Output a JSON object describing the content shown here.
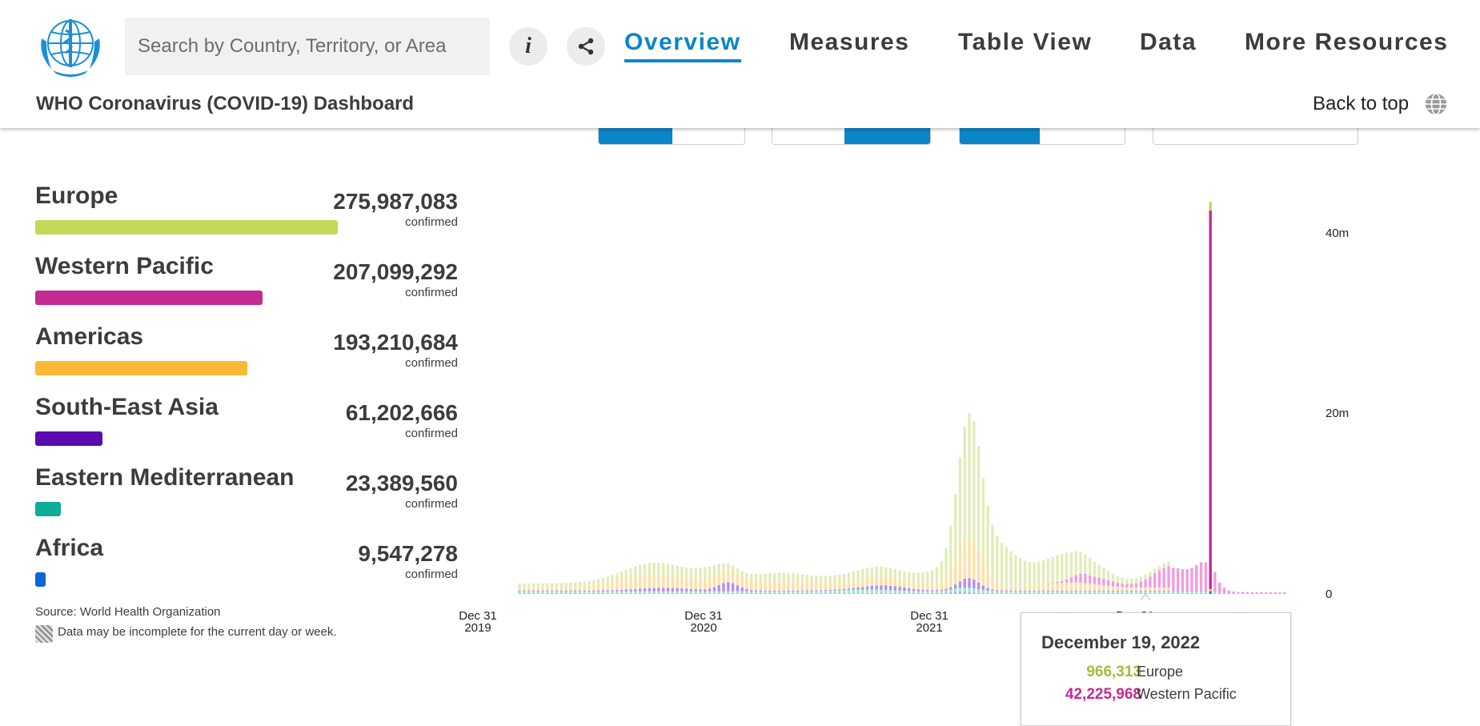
{
  "header": {
    "search_placeholder": "Search by Country, Territory, or Area",
    "info_icon": "info-icon",
    "share_icon": "share-icon",
    "nav": [
      "Overview",
      "Measures",
      "Table View",
      "Data",
      "More Resources"
    ],
    "active_nav": "Overview",
    "dashboard_title": "WHO Coronavirus (COVID-19) Dashboard",
    "back_to_top": "Back to top",
    "language_icon": "globe-icon",
    "logo": "who-emblem-logo"
  },
  "regions": [
    {
      "name": "Europe",
      "value": "275,987,083",
      "label": "confirmed",
      "color": "#c6d85a",
      "share": 1.0
    },
    {
      "name": "Western Pacific",
      "value": "207,099,292",
      "label": "confirmed",
      "color": "#c42a92",
      "share": 0.75
    },
    {
      "name": "Americas",
      "value": "193,210,684",
      "label": "confirmed",
      "color": "#fbb834",
      "share": 0.7
    },
    {
      "name": "South-East Asia",
      "value": "61,202,666",
      "label": "confirmed",
      "color": "#5a0bb0",
      "share": 0.222
    },
    {
      "name": "Eastern Mediterranean",
      "value": "23,389,560",
      "label": "confirmed",
      "color": "#0fad98",
      "share": 0.085
    },
    {
      "name": "Africa",
      "value": "9,547,278",
      "label": "confirmed",
      "color": "#0d66d6",
      "share": 0.035
    }
  ],
  "footer": {
    "source": "Source:  World Health Organization",
    "note": "Data may be incomplete for the current day or week."
  },
  "chart_data": {
    "type": "bar",
    "stacked": true,
    "x_ticks": [
      {
        "line1": "Dec 31",
        "line2": "2019"
      },
      {
        "line1": "Dec 31",
        "line2": "2020"
      },
      {
        "line1": "Dec 31",
        "line2": "2021"
      },
      {
        "line1": "Dec 31",
        "line2": ""
      }
    ],
    "y_ticks": [
      "40m",
      "20m",
      "0"
    ],
    "ylim": [
      0,
      44000000
    ],
    "week_interval_note": "weekly bars",
    "series": [
      {
        "name": "Europe",
        "color": "#c6d85a"
      },
      {
        "name": "Western Pacific",
        "color": "#c42a92"
      },
      {
        "name": "Americas",
        "color": "#fbb834"
      },
      {
        "name": "South-East Asia",
        "color": "#5a0bb0"
      },
      {
        "name": "Eastern Mediterranean",
        "color": "#0fad98"
      },
      {
        "name": "Africa",
        "color": "#0d66d6"
      }
    ],
    "highlight_date": "December 19, 2022",
    "highlight_values": {
      "Europe": 966313,
      "Western Pacific": 42225968
    }
  },
  "tooltip": {
    "date": "December 19, 2022",
    "rows": [
      {
        "value": "966,313",
        "name": "Europe",
        "color": "#a9bb3a"
      },
      {
        "value": "42,225,968",
        "name": "Western Pacific",
        "color": "#c42a92"
      }
    ]
  }
}
